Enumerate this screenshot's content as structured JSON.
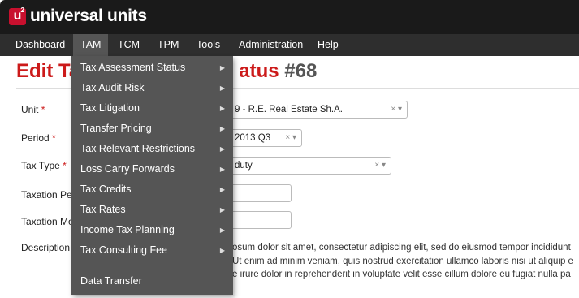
{
  "brand": {
    "logo_letter": "u",
    "logo_sup": "2",
    "name": "universal units",
    "accent": "#c8102e"
  },
  "nav": {
    "items": [
      {
        "label": "Dashboard"
      },
      {
        "label": "TAM"
      },
      {
        "label": "TCM"
      },
      {
        "label": "TPM"
      },
      {
        "label": "Tools"
      },
      {
        "label": "Administration"
      },
      {
        "label": "Help"
      }
    ],
    "active": "TAM"
  },
  "page": {
    "title_start": "Edit Ta",
    "title_end": "atus",
    "record_number": "#68"
  },
  "form": {
    "unit_label": "Unit",
    "unit_value": "9 - R.E. Real Estate Sh.A.",
    "period_label": "Period",
    "period_value": "2013 Q3",
    "tax_type_label": "Tax Type",
    "tax_type_value": "duty",
    "taxation_period_label": "Taxation Pe",
    "taxation_mode_label": "Taxation Mo",
    "description_label": "Description",
    "required_mark": "*",
    "clear_symbol": "×",
    "dropdown_symbol": "▾",
    "description_lines": [
      "osum dolor sit amet, consectetur adipiscing elit, sed do eiusmod tempor incididunt",
      "Ut enim ad minim veniam, quis nostrud exercitation ullamco laboris nisi ut aliquip e",
      "e irure dolor in reprehenderit in voluptate velit esse cillum dolore eu fugiat nulla pa"
    ]
  },
  "tam_menu": {
    "items": [
      {
        "label": "Tax Assessment Status",
        "arrow": "▶"
      },
      {
        "label": "Tax Audit Risk",
        "arrow": "▶"
      },
      {
        "label": "Tax Litigation",
        "arrow": "▶"
      },
      {
        "label": "Transfer Pricing",
        "arrow": "▶"
      },
      {
        "label": "Tax Relevant Restrictions",
        "arrow": "▶"
      },
      {
        "label": "Loss Carry Forwards",
        "arrow": "▶"
      },
      {
        "label": "Tax Credits",
        "arrow": "▶"
      },
      {
        "label": "Tax Rates",
        "arrow": "▶"
      },
      {
        "label": "Income Tax Planning",
        "arrow": "▶"
      },
      {
        "label": "Tax Consulting Fee",
        "arrow": "▶"
      }
    ],
    "footer_item": "Data Transfer"
  }
}
